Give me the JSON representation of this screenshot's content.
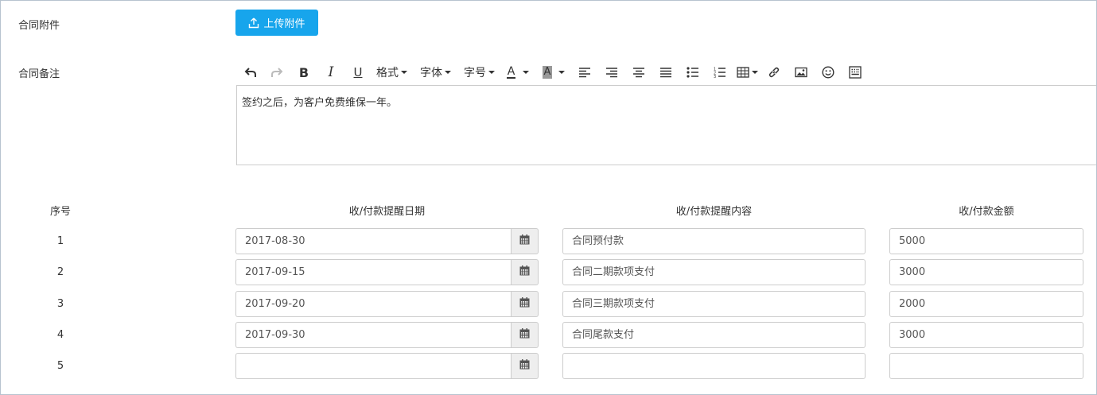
{
  "attachment": {
    "label": "合同附件",
    "upload_button": "上传附件",
    "upload_icon": "upload-icon"
  },
  "remark": {
    "label": "合同备注",
    "toolbar": {
      "undo_icon": "undo-icon",
      "redo_icon": "redo-icon",
      "bold": "B",
      "italic": "I",
      "underline": "U",
      "format": "格式",
      "font": "字体",
      "fontsize": "字号",
      "font_color": "A",
      "bg_color": "A"
    },
    "content": "签约之后，为客户免费维保一年。"
  },
  "schedule": {
    "headers": {
      "index": "序号",
      "date": "收/付款提醒日期",
      "content": "收/付款提醒内容",
      "amount": "收/付款金额"
    },
    "rows": [
      {
        "index": "1",
        "date": "2017-08-30",
        "content": "合同预付款",
        "amount": "5000"
      },
      {
        "index": "2",
        "date": "2017-09-15",
        "content": "合同二期款项支付",
        "amount": "3000"
      },
      {
        "index": "3",
        "date": "2017-09-20",
        "content": "合同三期款项支付",
        "amount": "2000"
      },
      {
        "index": "4",
        "date": "2017-09-30",
        "content": "合同尾款支付",
        "amount": "3000"
      },
      {
        "index": "5",
        "date": "",
        "content": "",
        "amount": ""
      }
    ]
  },
  "colors": {
    "primary": "#17a5ec",
    "border": "#cccccc",
    "addon_bg": "#eeeeee"
  }
}
